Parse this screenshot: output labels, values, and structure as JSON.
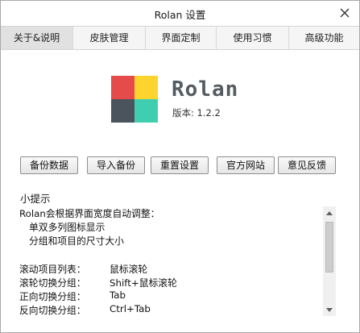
{
  "window": {
    "title": "Rolan 设置"
  },
  "tabs": [
    {
      "label": "关于&说明",
      "active": true
    },
    {
      "label": "皮肤管理",
      "active": false
    },
    {
      "label": "界面定制",
      "active": false
    },
    {
      "label": "使用习惯",
      "active": false
    },
    {
      "label": "高级功能",
      "active": false
    }
  ],
  "about": {
    "app_name": "Rolan",
    "version": "版本: 1.2.2",
    "logo_colors": [
      "#e64b4b",
      "#fdd42e",
      "#4b545c",
      "#3fcfb0"
    ]
  },
  "buttons": {
    "backup": "备份数据",
    "import": "导入备份",
    "reset": "重置设置",
    "website": "官方网站",
    "feedback": "意见反馈"
  },
  "tips": {
    "title": "小提示",
    "lines": [
      "Rolan会根据界面宽度自动调整：",
      "单双多列图标显示",
      "分组和项目的尺寸大小"
    ],
    "shortcuts": [
      {
        "action": "滚动项目列表：",
        "key": "鼠标滚轮"
      },
      {
        "action": "滚轮切换分组：",
        "key": "Shift+鼠标滚轮"
      },
      {
        "action": "正向切换分组：",
        "key": "Tab"
      },
      {
        "action": "反向切换分组：",
        "key": "Ctrl+Tab"
      }
    ]
  },
  "scrollbar": {
    "position_fraction": 0.0
  }
}
